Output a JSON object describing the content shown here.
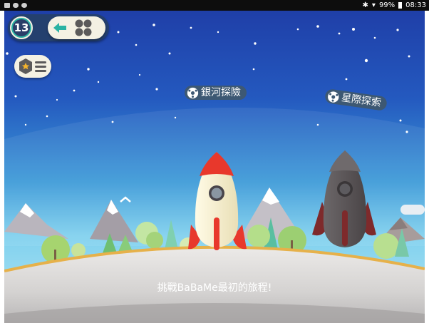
{
  "status_bar": {
    "battery": "99%",
    "time": "08:33",
    "icons_left": [
      "image-icon",
      "cloud-icon",
      "settings-notify-icon"
    ],
    "icons_right": [
      "bluetooth-icon",
      "wifi-icon",
      "battery-icon"
    ]
  },
  "hud": {
    "level": "13",
    "back_icon": "arrow-left-icon",
    "grid_icon": "four-dots-icon",
    "menu_icons": [
      "star-hexagon-icon",
      "list-icon"
    ]
  },
  "missions": [
    {
      "label": "銀河探險"
    },
    {
      "label": "星際探索"
    }
  ],
  "caption": "挑戰BaBaMe最初的旅程!",
  "colors": {
    "sky_top": "#1f3fa8",
    "sky_mid": "#2f7fd0",
    "sky_horizon": "#7fd0ee",
    "pill_bg": "#f4f1e3",
    "label_bg": "#3d5873",
    "ring_teal": "#2ab3a3",
    "rocket_red": "#e8382c",
    "rocket_cream": "#f6efd0",
    "rocket_dark": "#5c5759",
    "ground": "#e7e5e4"
  }
}
